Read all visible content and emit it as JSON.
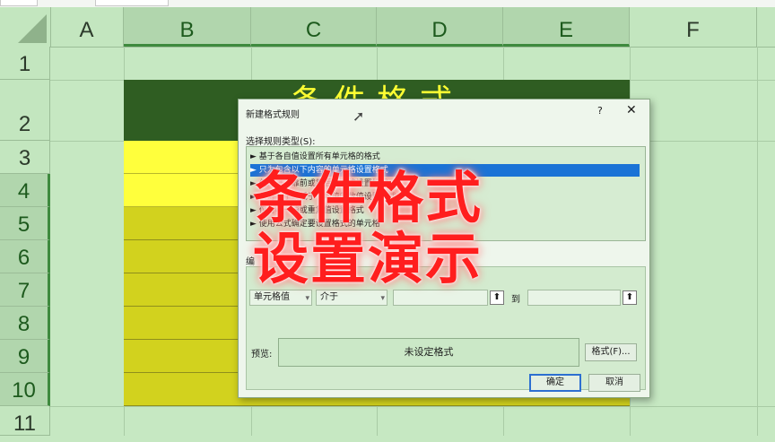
{
  "columns": [
    "A",
    "B",
    "C",
    "D",
    "E",
    "F"
  ],
  "rows": [
    "1",
    "2",
    "3",
    "4",
    "5",
    "6",
    "7",
    "8",
    "9",
    "10",
    "11"
  ],
  "sheet": {
    "title_cell": "条件格式"
  },
  "dialog": {
    "title": "新建格式规则",
    "help": "?",
    "close": "✕",
    "rule_type_label": "选择规则类型(S):",
    "rule_items": [
      "► 基于各自值设置所有单元格的格式",
      "► 只为包含以下内容的单元格设置格式",
      "► 仅对排名靠前或靠后的数值设置格式",
      "► 仅对高于或低于平均值的数值设置格式",
      "► 仅对唯一值或重复值设置格式",
      "► 使用公式确定要设置格式的单元格"
    ],
    "active_rule_index": 1,
    "desc_label": "编",
    "condition_field": "单元格值",
    "operator_field": "介于",
    "to_label": "到",
    "preview_label": "预览:",
    "preview_text": "未设定格式",
    "format_button": "格式(F)...",
    "ok_button": "确定",
    "cancel_button": "取消"
  },
  "overlay": {
    "line1": "条件格式",
    "line2": "设置演示"
  },
  "colors": {
    "background": "#c6e8c2",
    "title_fill": "#2f5d22",
    "title_text": "#ffff33",
    "yellow": "#ffff3c",
    "olive": "#d2d21e",
    "overlay_text": "#ff1e1e"
  }
}
